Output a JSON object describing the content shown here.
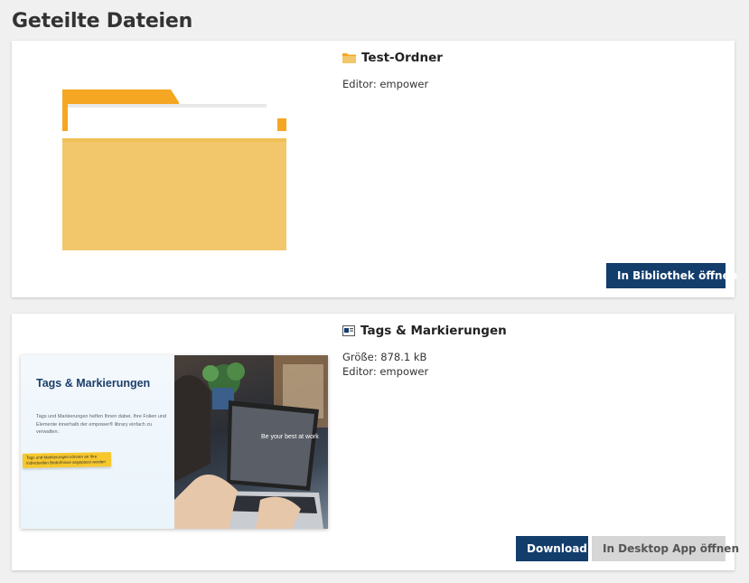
{
  "page": {
    "title": "Geteilte Dateien"
  },
  "files": [
    {
      "icon": "folder-icon",
      "title": "Test-Ordner",
      "editor": "Editor: empower",
      "actions": {
        "library": "In Bibliothek öffnen"
      }
    },
    {
      "icon": "presentation-icon",
      "title": "Tags & Markierungen",
      "size": "Größe: 878.1 kB",
      "editor": "Editor: empower",
      "actions": {
        "download": "Download",
        "desktop": "In Desktop App öffnen"
      },
      "preview": {
        "slide_title": "Tags & Markierungen",
        "slide_body": "Tags und Markierungen helfen Ihnen dabei, Ihre Folien und Elemente innerhalb der empower® library einfach zu verwalten.",
        "slide_note": "Tags und Markierungen können an Ihre individuellen Bedürfnisse angepasst werden",
        "screen_text": "Be your best at work"
      }
    }
  ],
  "colors": {
    "primary": "#133d6b",
    "secondary": "#d6d6d6",
    "folder": "#f2c76b",
    "folder_tab": "#f7a72b"
  }
}
